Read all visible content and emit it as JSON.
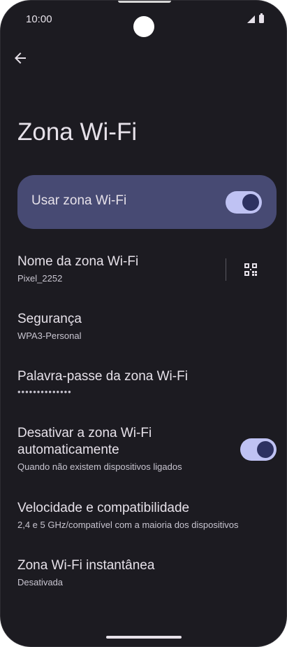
{
  "status_bar": {
    "time": "10:00"
  },
  "page": {
    "title": "Zona Wi-Fi"
  },
  "main_toggle": {
    "label": "Usar zona Wi-Fi",
    "state": "on"
  },
  "settings": [
    {
      "title": "Nome da zona Wi-Fi",
      "subtitle": "Pixel_2252"
    },
    {
      "title": "Segurança",
      "subtitle": "WPA3-Personal"
    },
    {
      "title": "Palavra-passe da zona Wi-Fi",
      "subtitle": "••••••••••••••"
    },
    {
      "title": "Desativar a zona Wi-Fi automaticamente",
      "title_line1": "Desativar a zona Wi-Fi",
      "title_line2": "automaticamente",
      "subtitle": "Quando não existem dispositivos ligados",
      "toggle": "on"
    },
    {
      "title": "Velocidade e compatibilidade",
      "subtitle": "2,4 e 5 GHz/compatível com a maioria dos dispositivos"
    },
    {
      "title": "Zona Wi-Fi instantânea",
      "subtitle": "Desativada"
    }
  ],
  "icons": {
    "back": "arrow-back-icon",
    "qr": "qr-code-icon",
    "signal": "signal-icon",
    "battery": "battery-icon"
  },
  "colors": {
    "background": "#1c1b21",
    "card": "#474a73",
    "toggle_track": "#bfc2f3",
    "toggle_thumb": "#2d3161",
    "text_primary": "#e6e1e9",
    "text_secondary": "#c8c5d0"
  }
}
